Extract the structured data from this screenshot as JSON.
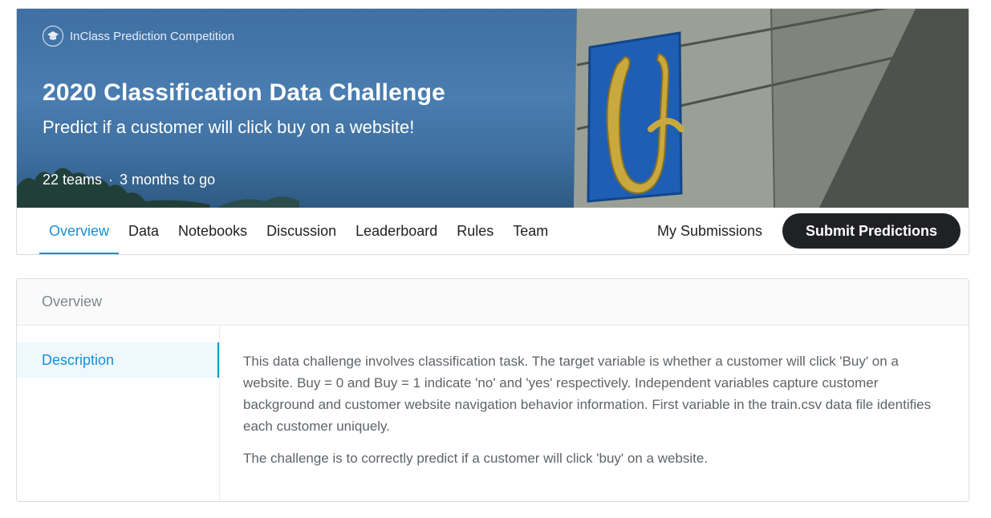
{
  "banner": {
    "competition_type": "InClass Prediction Competition",
    "title": "2020 Classification Data Challenge",
    "subtitle": "Predict if a customer will click buy on a website!",
    "teams": "22 teams",
    "separator": "·",
    "time_left": "3 months to go",
    "icon": "graduation-cap-icon"
  },
  "tabs": [
    {
      "label": "Overview",
      "active": true
    },
    {
      "label": "Data"
    },
    {
      "label": "Notebooks"
    },
    {
      "label": "Discussion"
    },
    {
      "label": "Leaderboard"
    },
    {
      "label": "Rules"
    },
    {
      "label": "Team"
    }
  ],
  "actions": {
    "my_submissions": "My Submissions",
    "submit": "Submit Predictions"
  },
  "overview": {
    "header": "Overview",
    "side_nav": [
      {
        "label": "Description",
        "active": true
      }
    ],
    "paragraphs": [
      "This data challenge involves classification task. The target variable is whether a customer will click 'Buy' on a website. Buy = 0 and Buy = 1 indicate 'no' and 'yes' respectively. Independent variables capture customer background and customer website navigation behavior information. First variable in the train.csv data file identifies each customer uniquely.",
      "The challenge is to correctly predict if a customer will click 'buy' on a website."
    ]
  },
  "colors": {
    "accent": "#1a8fd6",
    "button_bg": "#202124",
    "sky": "#4a7db0"
  }
}
